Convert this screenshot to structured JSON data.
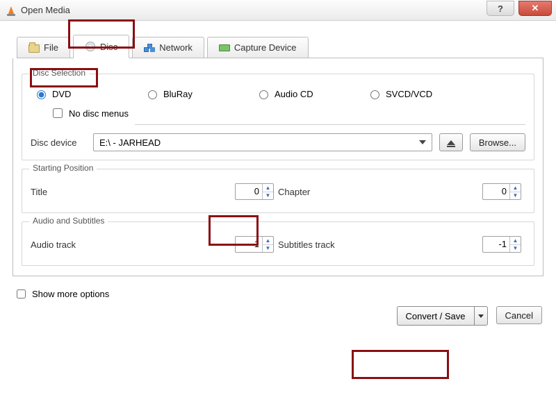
{
  "window": {
    "title": "Open Media"
  },
  "tabs": {
    "file": "File",
    "disc": "Disc",
    "network": "Network",
    "capture": "Capture Device",
    "selected": "disc"
  },
  "disc_selection": {
    "legend": "Disc Selection",
    "options": {
      "dvd": "DVD",
      "bluray": "BluRay",
      "audiocd": "Audio CD",
      "svcd": "SVCD/VCD"
    },
    "selected": "dvd",
    "no_menus_label": "No disc menus",
    "no_menus_checked": false,
    "device_label": "Disc device",
    "device_value": "E:\\ - JARHEAD",
    "browse_label": "Browse..."
  },
  "starting_position": {
    "legend": "Starting Position",
    "title_label": "Title",
    "title_value": "0",
    "chapter_label": "Chapter",
    "chapter_value": "0"
  },
  "audio_subs": {
    "legend": "Audio and Subtitles",
    "audio_label": "Audio track",
    "audio_value": "-1",
    "subs_label": "Subtitles track",
    "subs_value": "-1"
  },
  "footer": {
    "show_more_label": "Show more options",
    "show_more_checked": false,
    "convert_label": "Convert / Save",
    "cancel_label": "Cancel"
  }
}
